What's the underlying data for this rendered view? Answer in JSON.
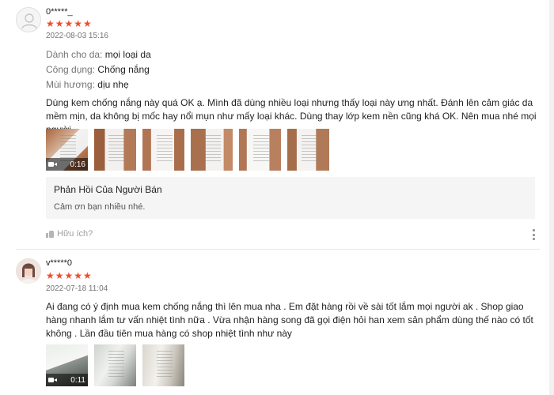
{
  "reviews": [
    {
      "author": "0*****_",
      "stars": "★★★★★",
      "date": "2022-08-03 15:16",
      "attributes": [
        {
          "label": "Dành cho da:",
          "value": "mọi loại da"
        },
        {
          "label": "Công dụng:",
          "value": "Chống nắng"
        },
        {
          "label": "Mùi hương:",
          "value": "dịu nhẹ"
        }
      ],
      "text": "Dùng kem chống nắng này quá OK ạ. Mình đã dùng nhiều loại nhưng thấy loại này ưng nhất. Đánh lên cảm giác da mềm mịn, da không bị mốc hay nổi mụn như mấy loại khác. Dùng thay lớp kem nền cũng khá OK. Nên mua nhé mọi người",
      "video_duration": "0:16",
      "seller_reply": {
        "title": "Phản Hồi Của Người Bán",
        "text": "Cảm ơn bạn nhiều nhé."
      },
      "helpful_label": "Hữu ích?"
    },
    {
      "author": "v*****0",
      "stars": "★★★★★",
      "date": "2022-07-18 11:04",
      "text": "Ai đang có ý định mua kem chống nắng thì lên mua nha . Em đặt hàng rồi về sài tốt lắm mọi người ak . Shop giao hàng nhanh lắm tư vấn nhiệt tình nữa . Vừa nhận hàng song đã gọi điện hỏi han xem sản phẩm dùng thế nào có tốt không . Lần đầu tiên mua hàng có shop nhiệt tình như này",
      "video_duration": "0:11"
    }
  ],
  "colors": {
    "star": "#ee4d2d",
    "muted": "#757575"
  }
}
